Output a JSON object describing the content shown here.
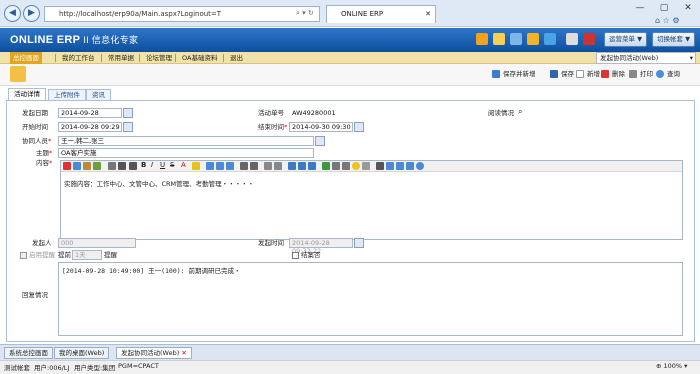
{
  "browser": {
    "address": "http://localhost/erp90a/Main.aspx?Loginout=T",
    "tab_title": "ONLINE ERP",
    "nav_icons": [
      "back-arrow-icon",
      "forward-arrow-icon"
    ],
    "window_controls": [
      "—",
      "▢",
      "✕"
    ]
  },
  "app": {
    "logo_text": "ONLINE ERP",
    "logo_suffix": "II 信息化专家",
    "header_buttons": [
      "运营菜单 ▼",
      "切换帐套 ▼"
    ]
  },
  "menu": [
    "总控画面",
    "我的工作台",
    "常用单据",
    "论坛管理",
    "OA基础资料",
    "退出"
  ],
  "crumb": "发起协同活动(Web)",
  "toolbar": [
    "保存并新增",
    "保存",
    "新增",
    "删除",
    "打印",
    "查询"
  ],
  "tabs": [
    "活动详情",
    "上传附件",
    "资讯"
  ],
  "form": {
    "start_date_label": "发起日期",
    "start_date": "2014-09-28",
    "activity_no_label": "活动单号",
    "activity_no": "AW49280001",
    "read_status_label": "阅读情况",
    "begin_time_label": "开始时间",
    "begin_time": "2014-09-28 09:29",
    "end_time_label": "结束时间",
    "end_time": "2014-09-30 09:30",
    "assist_label": "协同人员",
    "assist": "王一,韩二,张三",
    "subject_label": "主题",
    "subject": "OA客户实施",
    "content_label": "内容",
    "content": "实施内容：工作中心、文管中心、CRM管理、考勤管理・・・・・",
    "initiator_label": "发起人",
    "initiator": "000",
    "initiate_time_label": "发起时间",
    "initiate_time": "2014-09-28 09:32:22",
    "remind_enable_label": "启用提醒",
    "advance_label": "提前",
    "advance_value": "1天",
    "remind_label": "提醒",
    "close_label": "结案否",
    "reply_label": "回复情况",
    "reply": "[2014-09-28 10:49:00] 王一(100): 前期调研已完成・"
  },
  "bottom_tabs": [
    "系统总控画面",
    "我的桌面(Web)",
    "发起协同活动(Web)"
  ],
  "status": {
    "account": "测试帐套",
    "user": "用户:006/LJ",
    "user_type": "用户类型:集团",
    "pgm": "PGM=CPACT",
    "zoom": "100%"
  }
}
